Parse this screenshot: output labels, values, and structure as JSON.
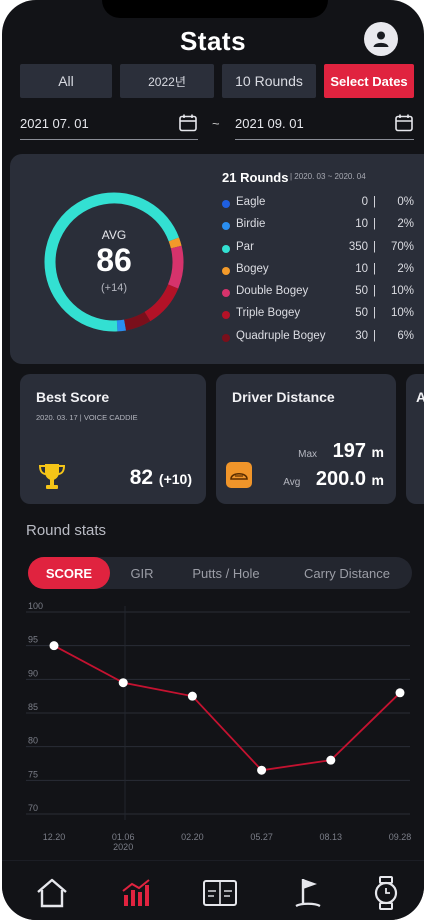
{
  "header": {
    "title": "Stats"
  },
  "filters": {
    "all": "All",
    "year": "2022년",
    "rounds": "10 Rounds",
    "select_dates": "Select Dates"
  },
  "date_range": {
    "start": "2021 07. 01",
    "separator": "~",
    "end": "2021 09. 01"
  },
  "summary": {
    "avg_label": "AVG",
    "avg_value": "86",
    "avg_diff": "(+14)",
    "rounds_title": "21 Rounds",
    "rounds_range": "| 2020. 03 ~ 2020. 04",
    "legend": [
      {
        "name": "Eagle",
        "count": "0",
        "pct": "0%",
        "color": "#1f5fe0",
        "value": 0
      },
      {
        "name": "Birdie",
        "count": "10",
        "pct": "2%",
        "color": "#2a8ef0",
        "value": 2
      },
      {
        "name": "Par",
        "count": "350",
        "pct": "70%",
        "color": "#33e0d2",
        "value": 70
      },
      {
        "name": "Bogey",
        "count": "10",
        "pct": "2%",
        "color": "#f39a2a",
        "value": 2
      },
      {
        "name": "Double Bogey",
        "count": "50",
        "pct": "10%",
        "color": "#d6336c",
        "value": 10
      },
      {
        "name": "Triple Bogey",
        "count": "50",
        "pct": "10%",
        "color": "#b31227",
        "value": 10
      },
      {
        "name": "Quadruple Bogey",
        "count": "30",
        "pct": "6%",
        "color": "#7a0f1b",
        "value": 6
      }
    ],
    "separator": "|"
  },
  "best_score": {
    "title": "Best Score",
    "subtitle": "2020. 03. 17 | VOICE CADDIE",
    "value": "82",
    "diff": "(+10)"
  },
  "driver": {
    "title": "Driver Distance",
    "max_label": "Max",
    "max_value": "197",
    "avg_label": "Avg",
    "avg_value": "200.0",
    "unit": "m"
  },
  "partial_card": {
    "title": "Av"
  },
  "round_stats": {
    "title": "Round stats",
    "tabs": [
      "SCORE",
      "GIR",
      "Putts / Hole",
      "Carry Distance"
    ],
    "active_tab": 0
  },
  "chart_data": {
    "type": "line",
    "x": [
      "12.20",
      "01.06",
      "02.20",
      "05.27",
      "08.13",
      "09.28"
    ],
    "x_sub": [
      "",
      "2020",
      "",
      "",
      "",
      ""
    ],
    "values": [
      95,
      89.5,
      87.5,
      76.5,
      78,
      88
    ],
    "yticks": [
      100,
      95,
      90,
      85,
      80,
      75,
      70
    ],
    "ylim": [
      70,
      100
    ],
    "line_color": "#c41230",
    "grid": true
  },
  "nav": {
    "items": [
      {
        "name": "home"
      },
      {
        "name": "stats"
      },
      {
        "name": "scorecard"
      },
      {
        "name": "course"
      },
      {
        "name": "watch"
      }
    ]
  }
}
